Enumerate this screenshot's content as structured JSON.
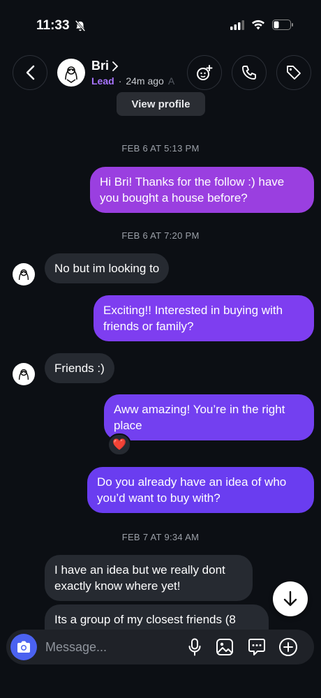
{
  "status_bar": {
    "time": "11:33"
  },
  "header": {
    "contact_name": "Bri",
    "label": "Lead",
    "separator": "·",
    "active": "24m ago",
    "active_extra": "A",
    "view_profile": "View profile"
  },
  "messages": {
    "ts1": "FEB 6 AT 5:13 PM",
    "m1": "Hi Bri! Thanks for the follow :) have you bought a house before?",
    "ts2": "FEB 6 AT 7:20 PM",
    "m2": "No but im looking to",
    "m3": "Exciting!! Interested in buying with friends or family?",
    "m4": "Friends :)",
    "m5": "Aww amazing! You’re in the right place",
    "m5_reaction": "❤️",
    "m6": "Do you already have an idea of who you’d want to buy with?",
    "ts3": "FEB 7 AT 9:34 AM",
    "m7": "I have an idea but we really dont exactly know where yet!",
    "m8": "Its a group of my closest friends (8"
  },
  "composer": {
    "placeholder": "Message..."
  },
  "colors": {
    "background": "#0c0f14",
    "incoming_bubble": "#262a31",
    "outgoing_top": "#9a3fe0",
    "outgoing_bottom": "#6a3df0",
    "lead_label": "#a874ff",
    "camera_button": "#4b62f0"
  },
  "icons": [
    "bell-slash-icon",
    "signal-icon",
    "wifi-icon",
    "battery-icon",
    "back-chevron-icon",
    "effects-icon",
    "phone-icon",
    "tag-icon",
    "arrow-down-icon",
    "camera-icon",
    "microphone-icon",
    "gallery-icon",
    "sticker-chat-icon",
    "plus-circle-icon"
  ]
}
